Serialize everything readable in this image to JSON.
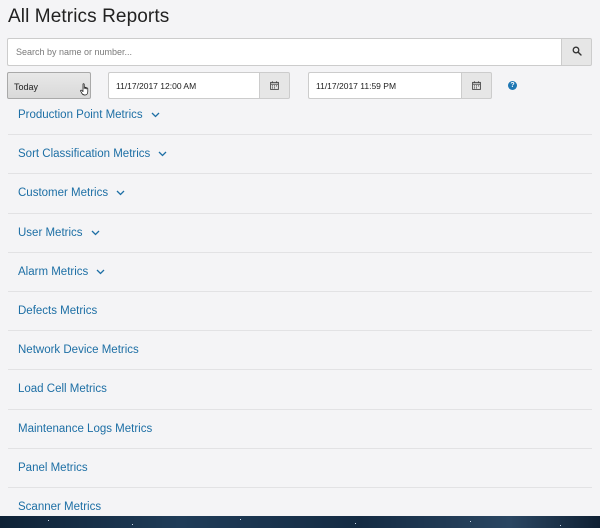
{
  "page": {
    "title": "All Metrics Reports"
  },
  "search": {
    "placeholder": "Search by name or number...",
    "button_icon": "search-icon"
  },
  "filters": {
    "range_value": "Today",
    "start_date": "11/17/2017 12:00 AM",
    "end_date": "11/17/2017 11:59 PM",
    "calendar_icon": "calendar-icon",
    "help_symbol": "?"
  },
  "metrics": [
    {
      "label": "Production Point Metrics",
      "expandable": true
    },
    {
      "label": "Sort Classification Metrics",
      "expandable": true
    },
    {
      "label": "Customer Metrics",
      "expandable": true
    },
    {
      "label": "User Metrics",
      "expandable": true
    },
    {
      "label": "Alarm Metrics",
      "expandable": true
    },
    {
      "label": "Defects Metrics",
      "expandable": false
    },
    {
      "label": "Network Device Metrics",
      "expandable": false
    },
    {
      "label": "Load Cell Metrics",
      "expandable": false
    },
    {
      "label": "Maintenance Logs Metrics",
      "expandable": false
    },
    {
      "label": "Panel Metrics",
      "expandable": false
    },
    {
      "label": "Scanner Metrics",
      "expandable": false
    }
  ],
  "colors": {
    "link": "#1d6fa5",
    "help": "#1f78b4",
    "background": "#f4f4f6"
  }
}
